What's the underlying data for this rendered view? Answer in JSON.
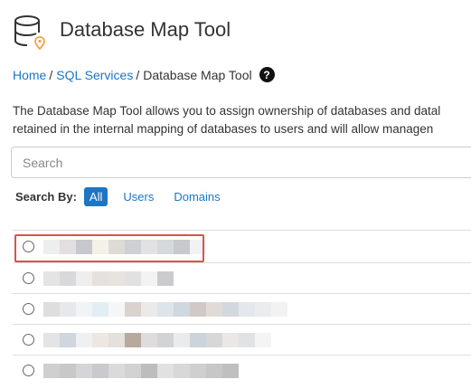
{
  "header": {
    "title": "Database Map Tool",
    "icon": "database-location-icon"
  },
  "breadcrumb": {
    "items": [
      {
        "label": "Home"
      },
      {
        "label": "SQL Services"
      },
      {
        "label": "Database Map Tool"
      }
    ],
    "separator": "/",
    "help_icon": "question-circle-icon"
  },
  "description": {
    "line1": "The Database Map Tool allows you to assign ownership of databases and datal",
    "line2": "retained in the internal mapping of databases to users and will allow managen"
  },
  "search": {
    "placeholder": "Search",
    "value": ""
  },
  "search_by": {
    "label": "Search By:",
    "options": [
      {
        "label": "All",
        "active": true
      },
      {
        "label": "Users",
        "active": false
      },
      {
        "label": "Domains",
        "active": false
      }
    ]
  },
  "results": {
    "rows": [
      {
        "selected": false,
        "highlighted": true,
        "redacted": true,
        "swatches": [
          "#eeeeee",
          "#e3dfe0",
          "#c7c8cb",
          "#f4f1e8",
          "#dedad6",
          "#ced0d3",
          "#e2e2e4",
          "#d6d9dc",
          "#c7c9cd",
          "#f0f2f4"
        ]
      },
      {
        "selected": false,
        "highlighted": false,
        "redacted": true,
        "swatches": [
          "#e4e4e4",
          "#d9d9dc",
          "#eeeeef",
          "#e6e1dd",
          "#e7e3df",
          "#e1e1e1",
          "#f3f3f3",
          "#cbcbcf"
        ]
      },
      {
        "selected": false,
        "highlighted": false,
        "redacted": true,
        "swatches": [
          "#dedede",
          "#e6e8eb",
          "#f0f4f6",
          "#e3eef3",
          "#f5f6f7",
          "#d9d2cf",
          "#ebe9ea",
          "#dde4ea",
          "#cfd7df",
          "#d1c9c8",
          "#e1dbd8",
          "#d2d8de",
          "#e4e8ec",
          "#eaeced",
          "#f2f2f2"
        ]
      },
      {
        "selected": false,
        "highlighted": false,
        "redacted": true,
        "swatches": [
          "#e4e4e6",
          "#cfd6de",
          "#eef0f2",
          "#ede7e3",
          "#e3e0dd",
          "#b7a99d",
          "#dfdcdd",
          "#d2d3d4",
          "#eaebec",
          "#cdd3da",
          "#d7d7d7",
          "#ebe7e4",
          "#e1e2e3",
          "#f4f4f4"
        ]
      },
      {
        "selected": false,
        "highlighted": false,
        "redacted": true,
        "swatches": [
          "#cfcfd1",
          "#c8c8ca",
          "#d5d5d8",
          "#cacace",
          "#dadadc",
          "#d2d2d4",
          "#bdbdc0",
          "#e1e1e1",
          "#d8d8da",
          "#cfcfd1",
          "#c7c7c9",
          "#bfbfc2"
        ]
      }
    ]
  },
  "colors": {
    "link": "#1c76c5",
    "active_filter_bg": "#1c76c5",
    "highlight_border": "#d9534f",
    "icon_accent": "#f0a24a"
  }
}
